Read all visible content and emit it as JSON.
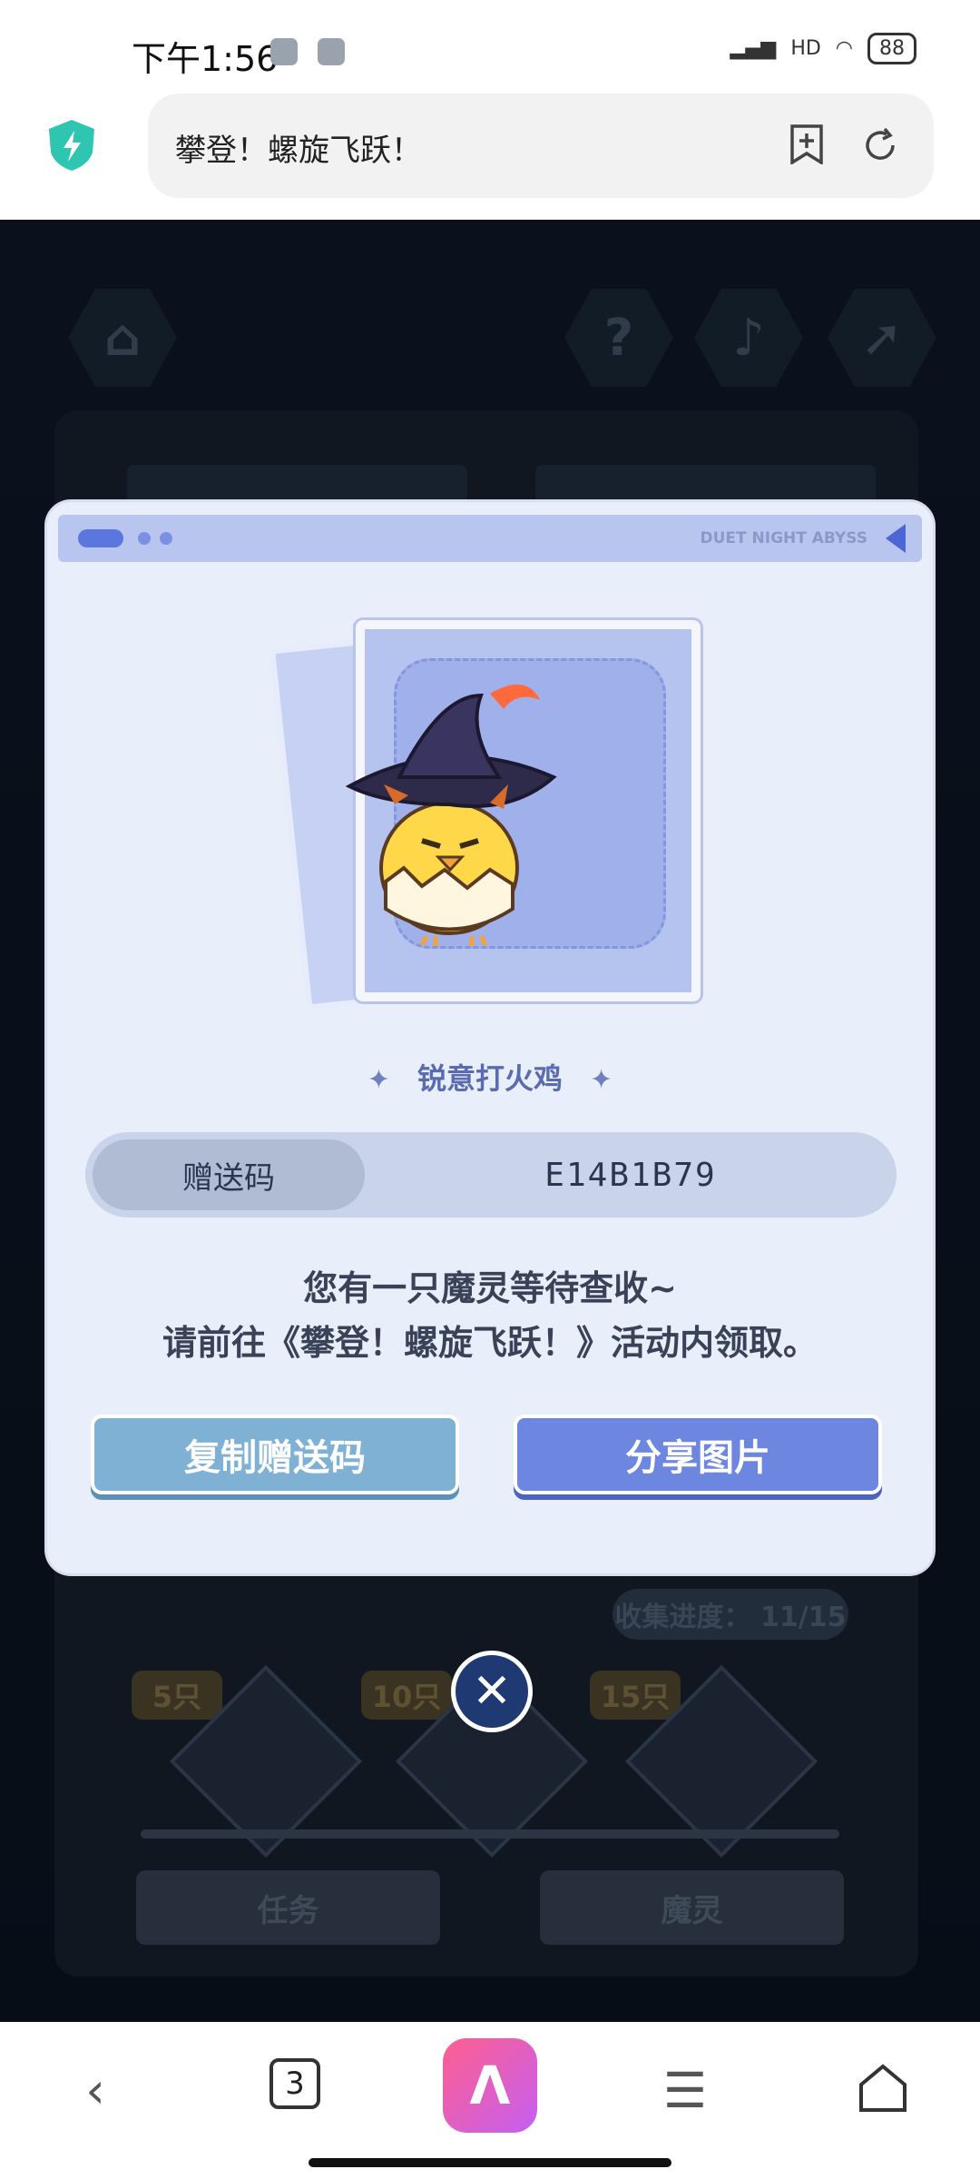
{
  "status_bar": {
    "time": "下午1:56",
    "network": "HD",
    "battery": "88"
  },
  "browser": {
    "page_title": "攀登！螺旋飞跃！",
    "tab_count": "3"
  },
  "background": {
    "progress": "收集进度： 11/15",
    "milestones": [
      "5只",
      "10只",
      "15只"
    ],
    "tabs": [
      "任务",
      "魔灵"
    ]
  },
  "modal": {
    "brand_text": "DUET NIGHT ABYSS",
    "item_name": "锐意打火鸡",
    "code_label": "赠送码",
    "code_value": "E14B1B79",
    "message_line1": "您有一只魔灵等待查收~",
    "message_line2": "请前往《攀登！螺旋飞跃！》活动内领取。",
    "copy_button": "复制赠送码",
    "share_button": "分享图片"
  },
  "colors": {
    "accent": "#6d86e0",
    "copy": "#7fb1d5",
    "modal_bg": "#e9effa"
  }
}
